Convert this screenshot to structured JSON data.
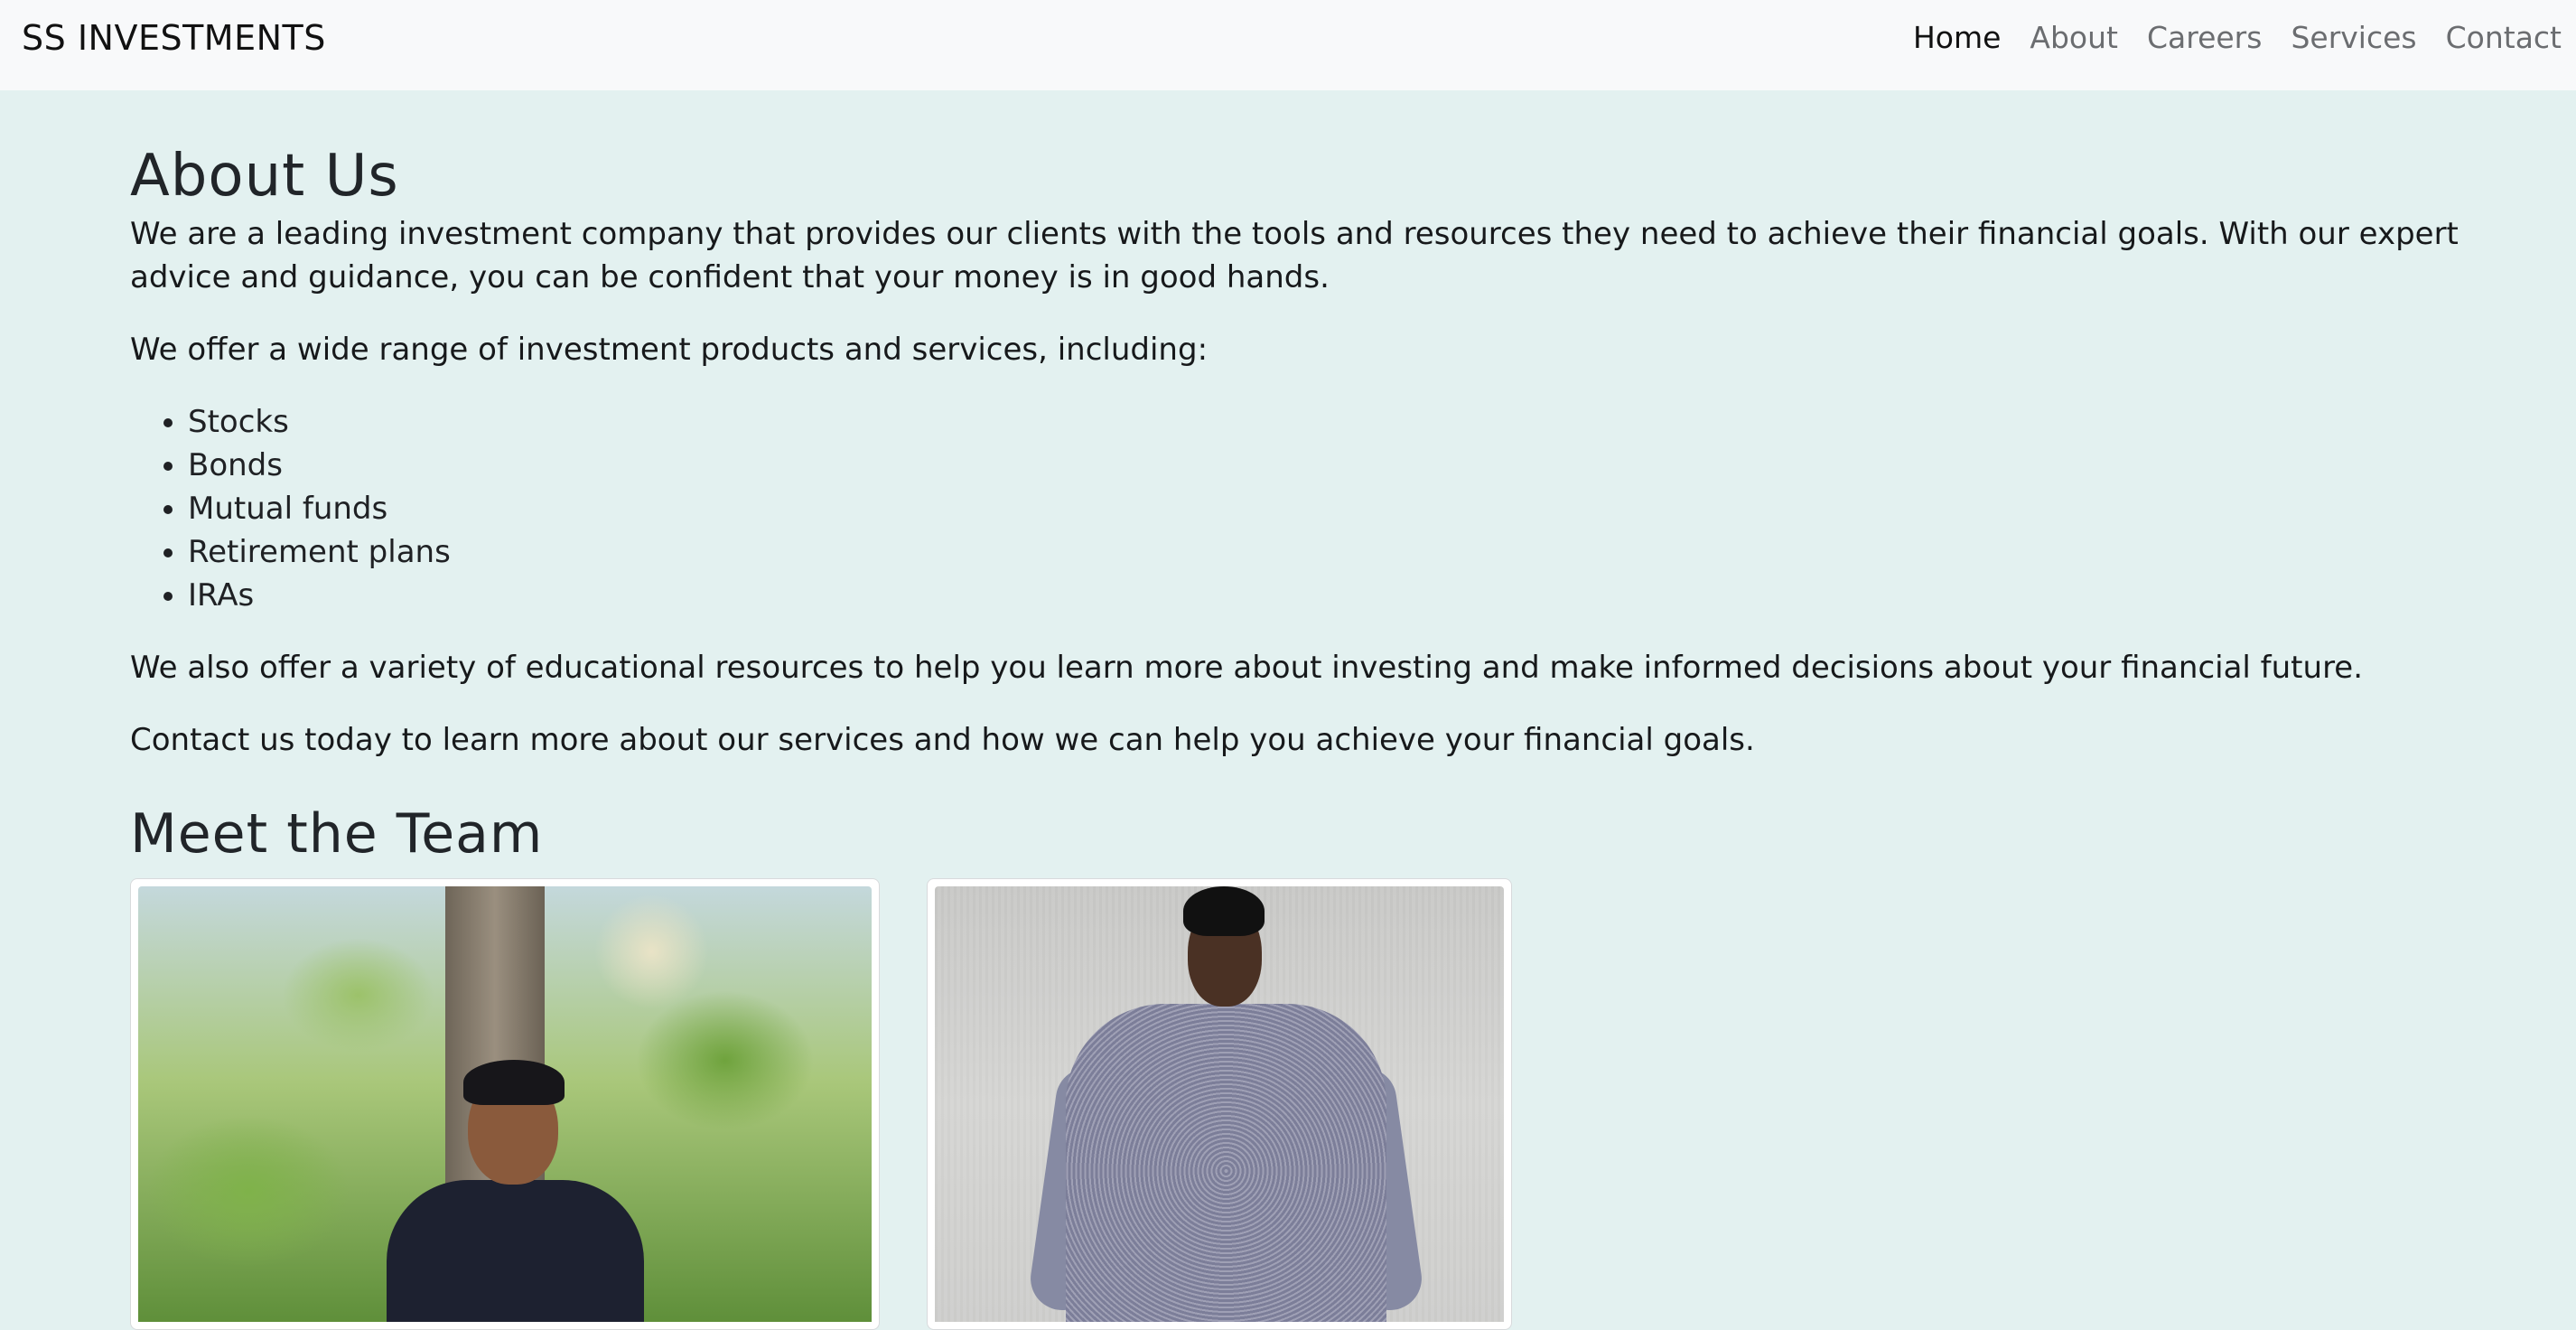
{
  "navbar": {
    "brand": "SS INVESTMENTS",
    "links": [
      {
        "label": "Home",
        "active": true
      },
      {
        "label": "About",
        "active": false
      },
      {
        "label": "Careers",
        "active": false
      },
      {
        "label": "Services",
        "active": false
      },
      {
        "label": "Contact",
        "active": false
      }
    ]
  },
  "about": {
    "title": "About Us",
    "intro": "We are a leading investment company that provides our clients with the tools and resources they need to achieve their financial goals. With our expert advice and guidance, you can be confident that your money is in good hands.",
    "offer_intro": "We offer a wide range of investment products and services, including:",
    "products": [
      "Stocks",
      "Bonds",
      "Mutual funds",
      "Retirement plans",
      "IRAs"
    ],
    "education": "We also offer a variety of educational resources to help you learn more about investing and make informed decisions about your financial future.",
    "contact": "Contact us today to learn more about our services and how we can help you achieve your financial goals."
  },
  "team": {
    "title": "Meet the Team"
  },
  "colors": {
    "page_background": "#e3f1f0",
    "navbar_background": "#f8f9fa",
    "nav_link": "#6b6d70",
    "nav_link_active": "#111111"
  }
}
